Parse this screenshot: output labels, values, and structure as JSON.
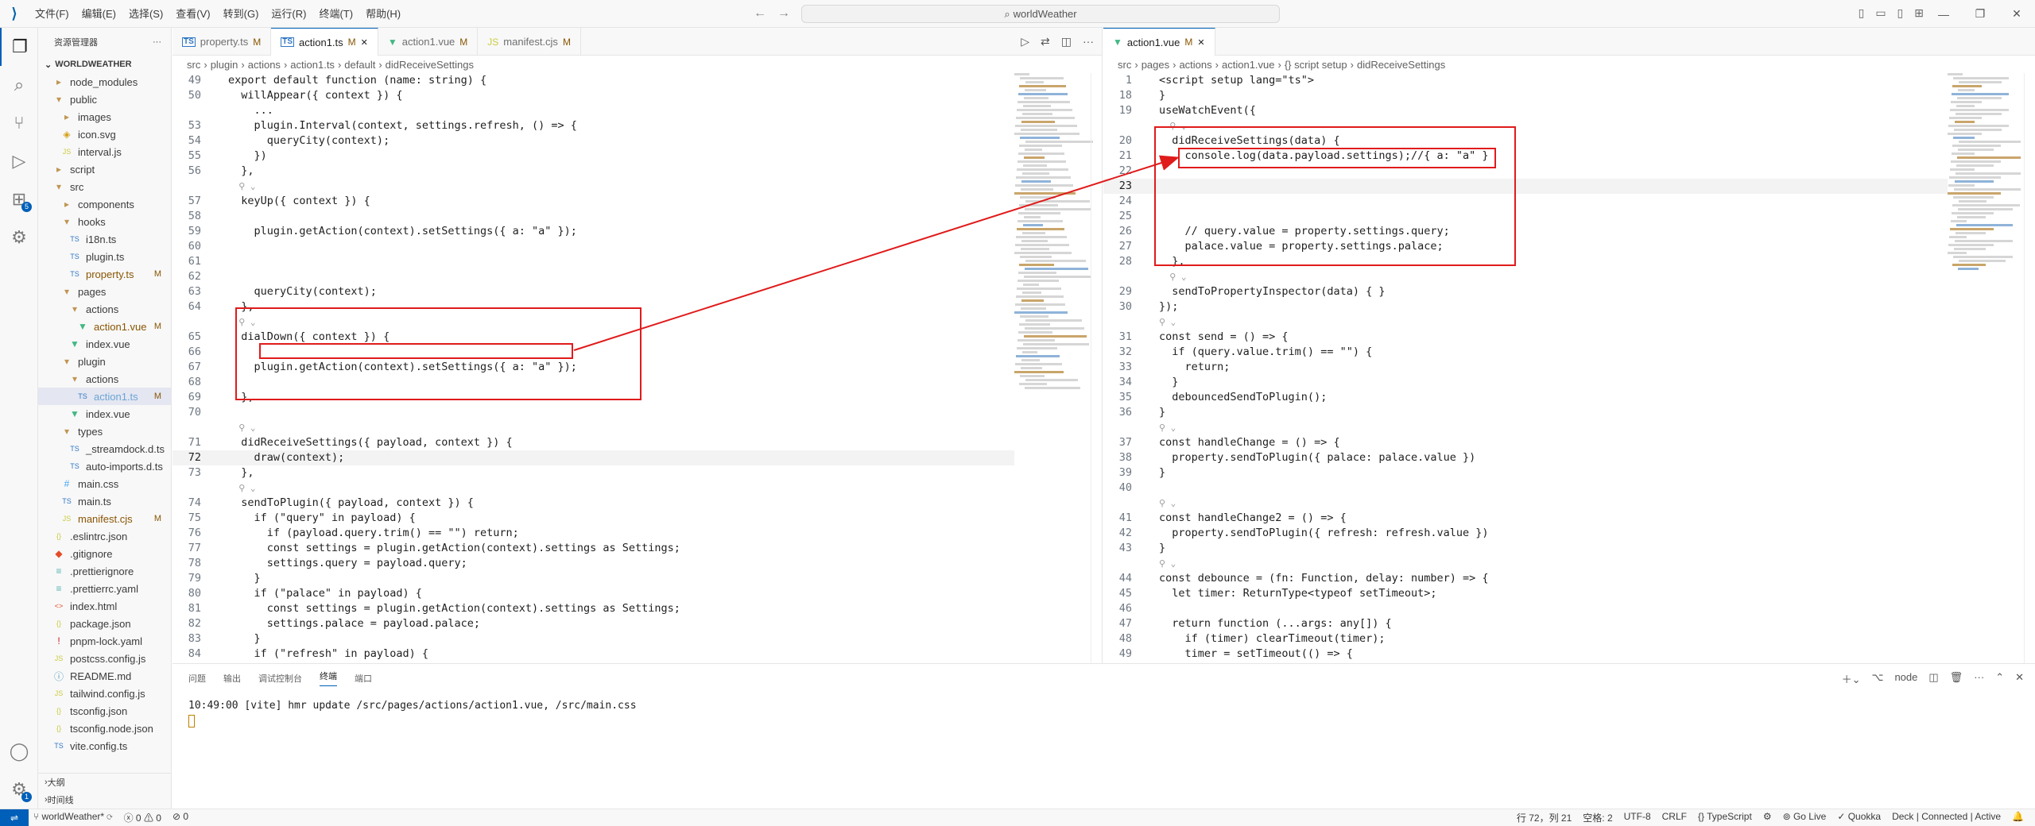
{
  "titlebar": {
    "menus": [
      "文件(F)",
      "编辑(E)",
      "选择(S)",
      "查看(V)",
      "转到(G)",
      "运行(R)",
      "终端(T)",
      "帮助(H)"
    ],
    "search": "worldWeather"
  },
  "sidebar": {
    "title": "资源管理器",
    "root": "WORLDWEATHER",
    "items": [
      {
        "label": "node_modules",
        "icon": "folder",
        "depth": 0
      },
      {
        "label": "public",
        "icon": "folder-open",
        "depth": 0
      },
      {
        "label": "images",
        "icon": "folder",
        "depth": 1
      },
      {
        "label": "icon.svg",
        "icon": "svg",
        "depth": 1
      },
      {
        "label": "interval.js",
        "icon": "js",
        "depth": 1
      },
      {
        "label": "script",
        "icon": "folder",
        "depth": 0
      },
      {
        "label": "src",
        "icon": "folder-open",
        "depth": 0
      },
      {
        "label": "components",
        "icon": "folder",
        "depth": 1
      },
      {
        "label": "hooks",
        "icon": "folder-open",
        "depth": 1
      },
      {
        "label": "i18n.ts",
        "icon": "ts",
        "depth": 2
      },
      {
        "label": "plugin.ts",
        "icon": "ts",
        "depth": 2
      },
      {
        "label": "property.ts",
        "icon": "ts",
        "depth": 2,
        "status": "M"
      },
      {
        "label": "pages",
        "icon": "folder-open",
        "depth": 1
      },
      {
        "label": "actions",
        "icon": "folder-open",
        "depth": 2
      },
      {
        "label": "action1.vue",
        "icon": "vue",
        "depth": 3,
        "status": "M"
      },
      {
        "label": "index.vue",
        "icon": "vue",
        "depth": 2
      },
      {
        "label": "plugin",
        "icon": "folder-open",
        "depth": 1
      },
      {
        "label": "actions",
        "icon": "folder-open",
        "depth": 2
      },
      {
        "label": "action1.ts",
        "icon": "ts",
        "depth": 3,
        "status": "M",
        "selected": true
      },
      {
        "label": "index.vue",
        "icon": "vue",
        "depth": 2
      },
      {
        "label": "types",
        "icon": "folder-open",
        "depth": 1
      },
      {
        "label": "_streamdock.d.ts",
        "icon": "ts",
        "depth": 2
      },
      {
        "label": "auto-imports.d.ts",
        "icon": "ts",
        "depth": 2
      },
      {
        "label": "main.css",
        "icon": "css",
        "depth": 1
      },
      {
        "label": "main.ts",
        "icon": "ts",
        "depth": 1
      },
      {
        "label": "manifest.cjs",
        "icon": "js",
        "depth": 1,
        "status": "M"
      },
      {
        "label": ".eslintrc.json",
        "icon": "json",
        "depth": 0
      },
      {
        "label": ".gitignore",
        "icon": "git",
        "depth": 0
      },
      {
        "label": ".prettierignore",
        "icon": "prettier",
        "depth": 0
      },
      {
        "label": ".prettierrc.yaml",
        "icon": "prettier",
        "depth": 0
      },
      {
        "label": "index.html",
        "icon": "html",
        "depth": 0
      },
      {
        "label": "package.json",
        "icon": "json",
        "depth": 0
      },
      {
        "label": "pnpm-lock.yaml",
        "icon": "yaml",
        "depth": 0
      },
      {
        "label": "postcss.config.js",
        "icon": "js",
        "depth": 0
      },
      {
        "label": "README.md",
        "icon": "md",
        "depth": 0
      },
      {
        "label": "tailwind.config.js",
        "icon": "js",
        "depth": 0
      },
      {
        "label": "tsconfig.json",
        "icon": "json",
        "depth": 0
      },
      {
        "label": "tsconfig.node.json",
        "icon": "json",
        "depth": 0
      },
      {
        "label": "vite.config.ts",
        "icon": "ts",
        "depth": 0
      }
    ],
    "sections": [
      "大纲",
      "时间线"
    ]
  },
  "editor_left": {
    "tabs": [
      {
        "label": "property.ts",
        "status": "M",
        "type": "ts"
      },
      {
        "label": "action1.ts",
        "status": "M",
        "type": "ts",
        "active": true
      },
      {
        "label": "action1.vue",
        "status": "M",
        "type": "vue"
      },
      {
        "label": "manifest.cjs",
        "status": "M",
        "type": "js"
      }
    ],
    "breadcrumb": [
      "src",
      "plugin",
      "actions",
      "action1.ts",
      "default",
      "didReceiveSettings"
    ],
    "lines": [
      {
        "n": "49",
        "t": "export default function (name: string) {"
      },
      {
        "n": "50",
        "t": "  willAppear({ context }) {"
      },
      {
        "n": "",
        "t": "    ..."
      },
      {
        "n": "53",
        "t": "    plugin.Interval(context, settings.refresh, () => {"
      },
      {
        "n": "54",
        "t": "      queryCity(context);"
      },
      {
        "n": "55",
        "t": "    })"
      },
      {
        "n": "56",
        "t": "  },"
      },
      {
        "n": "",
        "t": "  ⚲ ⌄",
        "lens": true
      },
      {
        "n": "57",
        "t": "  keyUp({ context }) {"
      },
      {
        "n": "58",
        "t": ""
      },
      {
        "n": "59",
        "t": "    plugin.getAction(context).setSettings({ a: \"a\" });"
      },
      {
        "n": "60",
        "t": ""
      },
      {
        "n": "61",
        "t": ""
      },
      {
        "n": "62",
        "t": ""
      },
      {
        "n": "63",
        "t": "    queryCity(context);"
      },
      {
        "n": "64",
        "t": "  },"
      },
      {
        "n": "",
        "t": "  ⚲ ⌄",
        "lens": true
      },
      {
        "n": "65",
        "t": "  dialDown({ context }) {"
      },
      {
        "n": "66",
        "t": ""
      },
      {
        "n": "67",
        "t": "    plugin.getAction(context).setSettings({ a: \"a\" });"
      },
      {
        "n": "68",
        "t": ""
      },
      {
        "n": "69",
        "t": "  },"
      },
      {
        "n": "70",
        "t": ""
      },
      {
        "n": "",
        "t": "  ⚲ ⌄",
        "lens": true
      },
      {
        "n": "71",
        "t": "  didReceiveSettings({ payload, context }) {"
      },
      {
        "n": "72",
        "t": "    draw(context);",
        "current": true
      },
      {
        "n": "73",
        "t": "  },"
      },
      {
        "n": "",
        "t": "  ⚲ ⌄",
        "lens": true
      },
      {
        "n": "74",
        "t": "  sendToPlugin({ payload, context }) {"
      },
      {
        "n": "75",
        "t": "    if (\"query\" in payload) {"
      },
      {
        "n": "76",
        "t": "      if (payload.query.trim() == \"\") return;"
      },
      {
        "n": "77",
        "t": "      const settings = plugin.getAction(context).settings as Settings;"
      },
      {
        "n": "78",
        "t": "      settings.query = payload.query;"
      },
      {
        "n": "79",
        "t": "    }"
      },
      {
        "n": "80",
        "t": "    if (\"palace\" in payload) {"
      },
      {
        "n": "81",
        "t": "      const settings = plugin.getAction(context).settings as Settings;"
      },
      {
        "n": "82",
        "t": "      settings.palace = payload.palace;"
      },
      {
        "n": "83",
        "t": "    }"
      },
      {
        "n": "84",
        "t": "    if (\"refresh\" in payload) {"
      },
      {
        "n": "85",
        "t": "      const settings = plugin.getAction(context).settings as Settings;"
      },
      {
        "n": "86",
        "t": "      settings.refresh = payload.refresh;"
      }
    ]
  },
  "editor_right": {
    "tabs": [
      {
        "label": "action1.vue",
        "status": "M",
        "type": "vue",
        "active": true
      }
    ],
    "breadcrumb": [
      "src",
      "pages",
      "actions",
      "action1.vue",
      "{} script setup",
      "didReceiveSettings"
    ],
    "lines": [
      {
        "n": "1",
        "t": "<script setup lang=\"ts\">"
      },
      {
        "n": "18",
        "t": "}"
      },
      {
        "n": "19",
        "t": "useWatchEvent({"
      },
      {
        "n": "",
        "t": "  ⚲ ⌄",
        "lens": true
      },
      {
        "n": "20",
        "t": "  didReceiveSettings(data) {"
      },
      {
        "n": "21",
        "t": "    console.log(data.payload.settings);//{ a: \"a\" }"
      },
      {
        "n": "22",
        "t": ""
      },
      {
        "n": "23",
        "t": "",
        "current": true
      },
      {
        "n": "24",
        "t": ""
      },
      {
        "n": "25",
        "t": ""
      },
      {
        "n": "26",
        "t": "    // query.value = property.settings.query;"
      },
      {
        "n": "27",
        "t": "    palace.value = property.settings.palace;"
      },
      {
        "n": "28",
        "t": "  },"
      },
      {
        "n": "",
        "t": "  ⚲ ⌄",
        "lens": true
      },
      {
        "n": "29",
        "t": "  sendToPropertyInspector(data) { }"
      },
      {
        "n": "30",
        "t": "});"
      },
      {
        "n": "",
        "t": "⚲ ⌄",
        "lens": true
      },
      {
        "n": "31",
        "t": "const send = () => {"
      },
      {
        "n": "32",
        "t": "  if (query.value.trim() == \"\") {"
      },
      {
        "n": "33",
        "t": "    return;"
      },
      {
        "n": "34",
        "t": "  }"
      },
      {
        "n": "35",
        "t": "  debouncedSendToPlugin();"
      },
      {
        "n": "36",
        "t": "}"
      },
      {
        "n": "",
        "t": "⚲ ⌄",
        "lens": true
      },
      {
        "n": "37",
        "t": "const handleChange = () => {"
      },
      {
        "n": "38",
        "t": "  property.sendToPlugin({ palace: palace.value })"
      },
      {
        "n": "39",
        "t": "}"
      },
      {
        "n": "40",
        "t": ""
      },
      {
        "n": "",
        "t": "⚲ ⌄",
        "lens": true
      },
      {
        "n": "41",
        "t": "const handleChange2 = () => {"
      },
      {
        "n": "42",
        "t": "  property.sendToPlugin({ refresh: refresh.value })"
      },
      {
        "n": "43",
        "t": "}"
      },
      {
        "n": "",
        "t": "⚲ ⌄",
        "lens": true
      },
      {
        "n": "44",
        "t": "const debounce = (fn: Function, delay: number) => {"
      },
      {
        "n": "45",
        "t": "  let timer: ReturnType<typeof setTimeout>;"
      },
      {
        "n": "46",
        "t": ""
      },
      {
        "n": "47",
        "t": "  return function (...args: any[]) {"
      },
      {
        "n": "48",
        "t": "    if (timer) clearTimeout(timer);"
      },
      {
        "n": "49",
        "t": "    timer = setTimeout(() => {"
      },
      {
        "n": "50",
        "t": "      fn.apply(this, args);"
      }
    ]
  },
  "panel": {
    "tabs": [
      "问题",
      "输出",
      "调试控制台",
      "终端",
      "端口"
    ],
    "active_tab": "终端",
    "shell": "node",
    "output": "10:49:00 [vite] hmr update /src/pages/actions/action1.vue, /src/main.css"
  },
  "statusbar": {
    "branch": "worldWeather*",
    "errors": "0",
    "warnings": "0",
    "ports": "0",
    "position": "行 72，列 21",
    "spaces": "空格: 2",
    "encoding": "UTF-8",
    "eol": "CRLF",
    "language": "TypeScript",
    "golive": "Go Live",
    "quokka": "Quokka",
    "deck": "Deck | Connected | Active"
  },
  "colors": {
    "accent": "#005fb8",
    "annotation": "#e01b1b",
    "modified": "#895503"
  }
}
